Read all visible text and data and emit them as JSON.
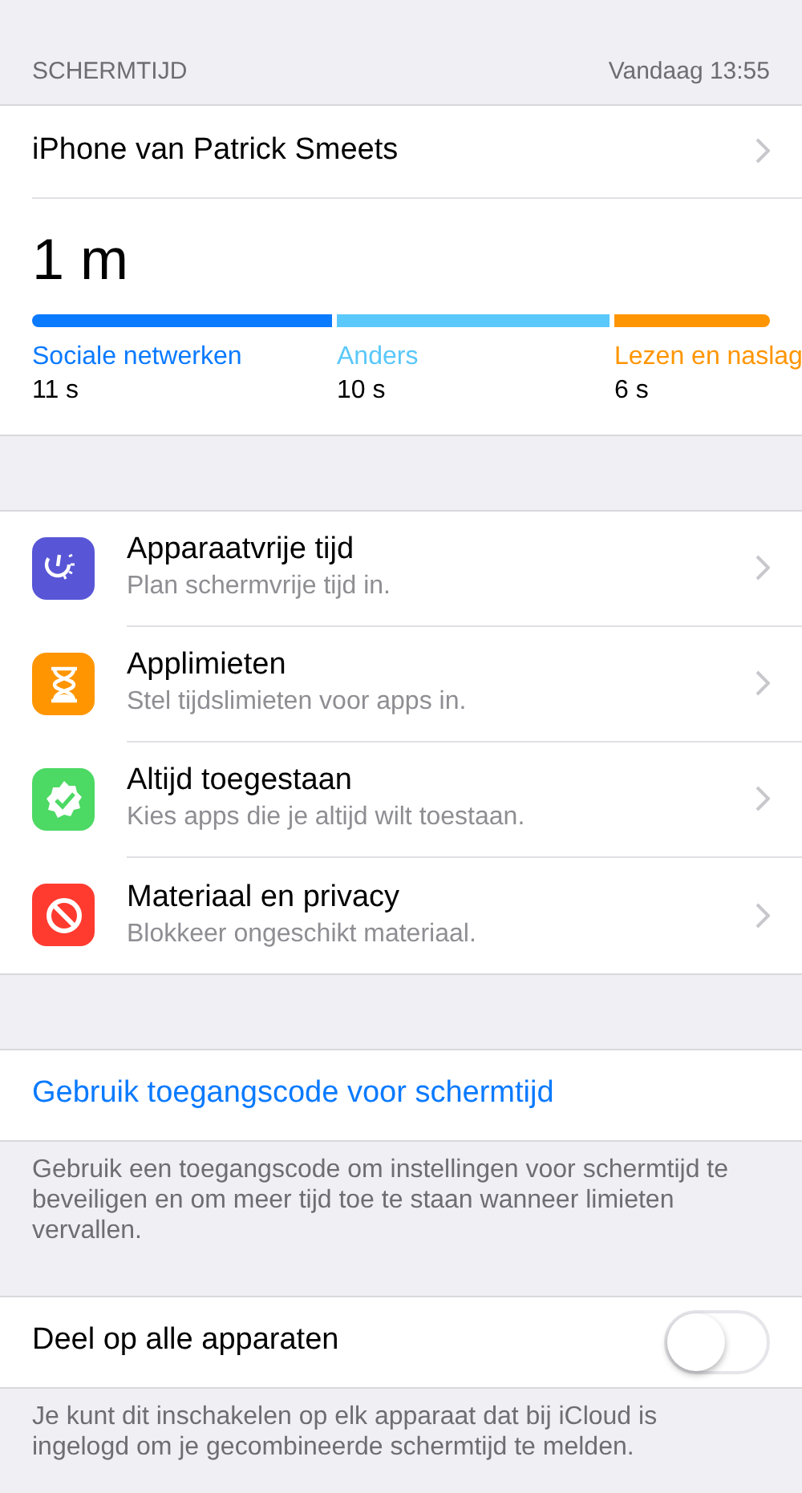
{
  "header": {
    "title": "SCHERMTIJD",
    "date": "Vandaag 13:55"
  },
  "device": {
    "name": "iPhone van Patrick Smeets"
  },
  "usage": {
    "total": "1 m",
    "categories": [
      {
        "name": "Sociale netwerken",
        "time": "11 s",
        "color": "#0a7aff"
      },
      {
        "name": "Anders",
        "time": "10 s",
        "color": "#5ac8fa"
      },
      {
        "name": "Lezen en naslag",
        "time": "6 s",
        "color": "#ff9500"
      }
    ]
  },
  "settings": [
    {
      "kind": "downtime",
      "color": "#5856d6",
      "title": "Apparaatvrije tijd",
      "subtitle": "Plan schermvrije tijd in."
    },
    {
      "kind": "limits",
      "color": "#ff9500",
      "title": "Applimieten",
      "subtitle": "Stel tijdslimieten voor apps in."
    },
    {
      "kind": "allowed",
      "color": "#4cd964",
      "title": "Altijd toegestaan",
      "subtitle": "Kies apps die je altijd wilt toestaan."
    },
    {
      "kind": "restrictions",
      "color": "#ff3b30",
      "title": "Materiaal en privacy",
      "subtitle": "Blokkeer ongeschikt materiaal."
    }
  ],
  "passcode": {
    "link": "Gebruik toegangscode voor schermtijd",
    "footer": "Gebruik een toegangscode om instellingen voor schermtijd te beveiligen en om meer tijd toe te staan wanneer limieten vervallen."
  },
  "share": {
    "label": "Deel op alle apparaten",
    "on": false,
    "footer": "Je kunt dit inschakelen op elk apparaat dat bij iCloud is ingelogd om je gecombineerde schermtijd te melden."
  }
}
